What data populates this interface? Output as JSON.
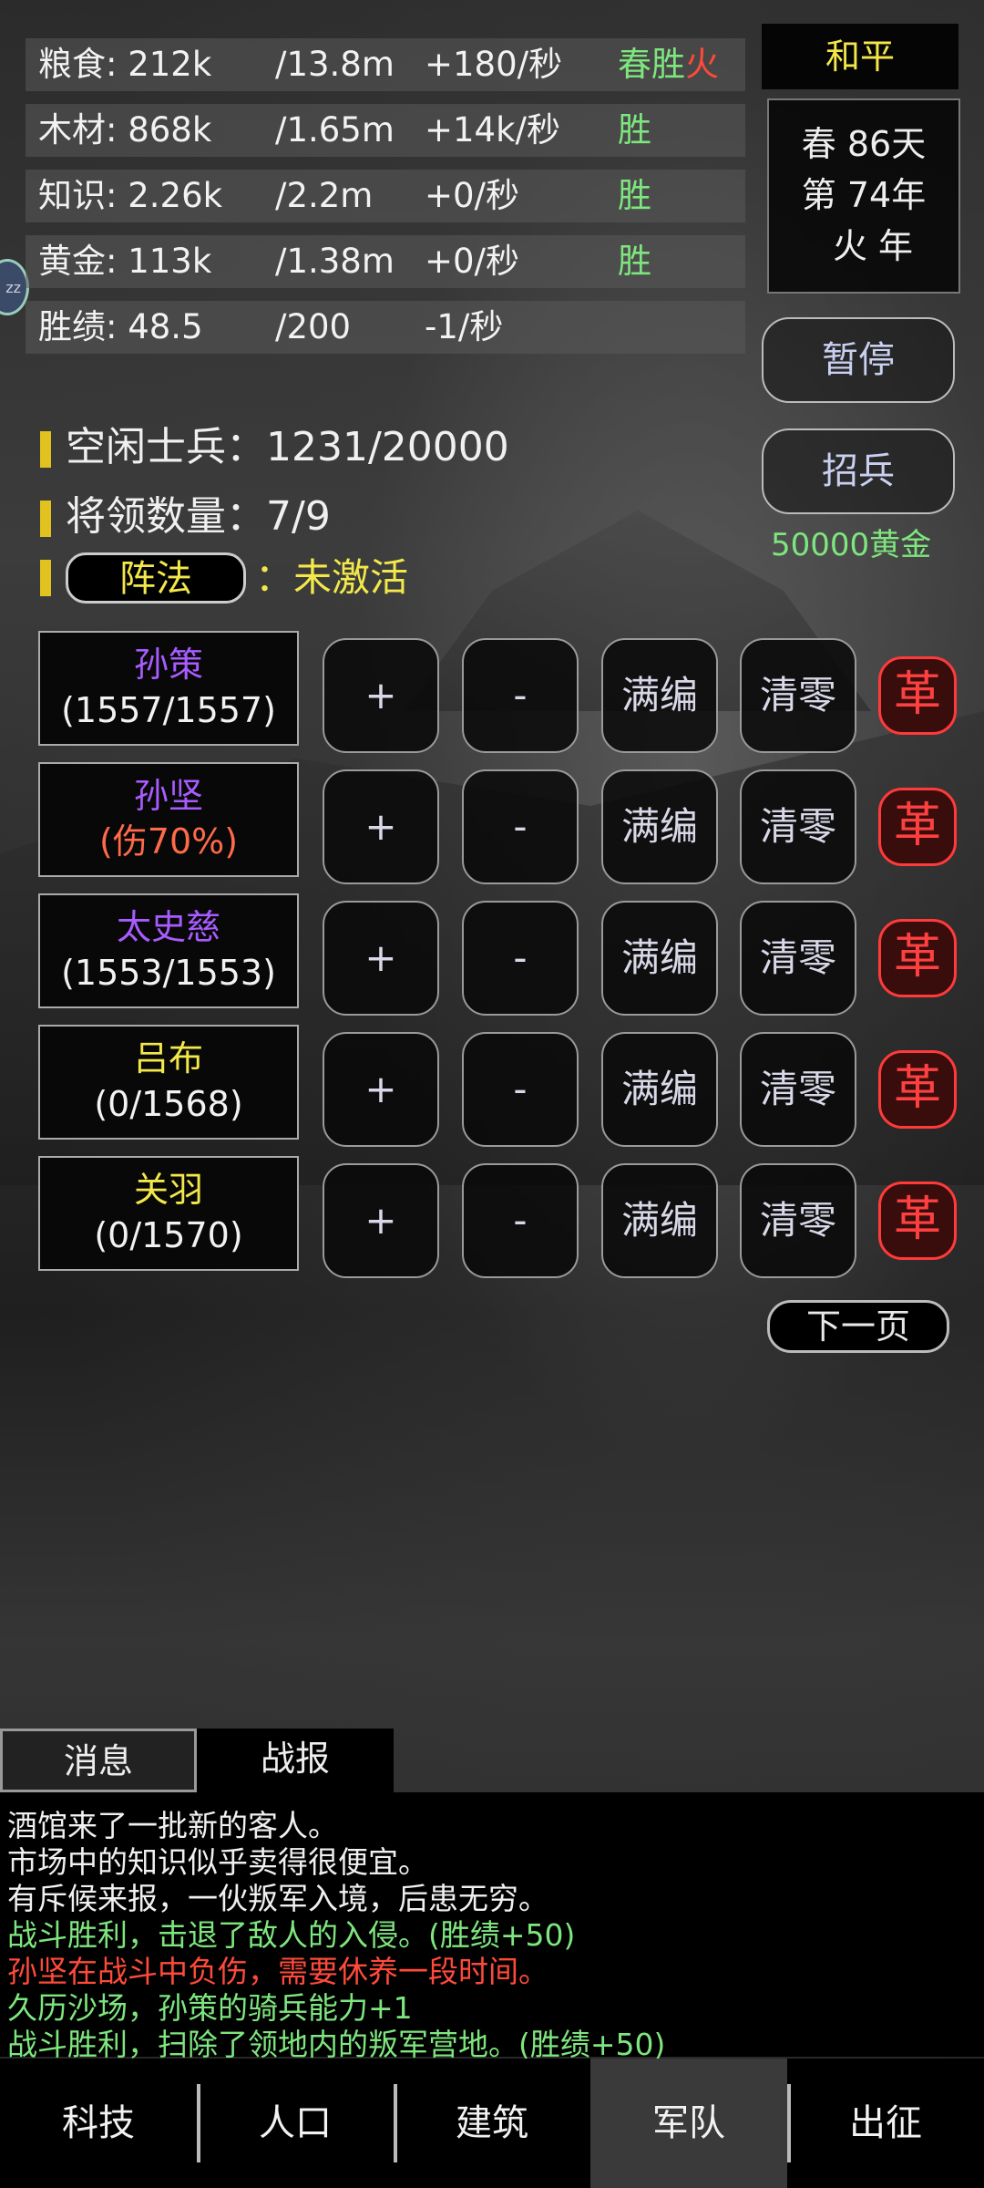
{
  "resources": [
    {
      "name": "粮食: 212k",
      "cap": "/13.8m",
      "rate": "+180/秒",
      "status": "春胜",
      "status_extra": "火"
    },
    {
      "name": "木材: 868k",
      "cap": "/1.65m",
      "rate": "+14k/秒",
      "status": "胜",
      "status_extra": ""
    },
    {
      "name": "知识: 2.26k",
      "cap": "/2.2m",
      "rate": "+0/秒",
      "status": "胜",
      "status_extra": ""
    },
    {
      "name": "黄金: 113k",
      "cap": "/1.38m",
      "rate": "+0/秒",
      "status": "胜",
      "status_extra": ""
    },
    {
      "name": "胜绩: 48.5",
      "cap": "/200",
      "rate": "-1/秒",
      "status": "",
      "status_extra": ""
    }
  ],
  "state": {
    "peace": "和平",
    "season_day": "春 86天",
    "year": "第 74年",
    "element_year": "火 年"
  },
  "buttons": {
    "pause": "暂停",
    "recruit": "招兵",
    "recruit_cost": "50000黄金",
    "next_page": "下一页"
  },
  "army": {
    "idle_soldiers": "空闲士兵：1231/20000",
    "generals_count": "将领数量：7/9",
    "formation_label": "阵法",
    "formation_status": "：未激活"
  },
  "generals": [
    {
      "name": "孙策",
      "troops": "(1557/1557)"
    },
    {
      "name": "孙坚",
      "troops": "(伤70%)"
    },
    {
      "name": "太史慈",
      "troops": "(1553/1553)"
    },
    {
      "name": "吕布",
      "troops": "(0/1568)"
    },
    {
      "name": "关羽",
      "troops": "(0/1570)"
    }
  ],
  "general_controls": {
    "add": "+",
    "remove": "-",
    "fill": "满编",
    "clear": "清零",
    "dismiss": "革"
  },
  "tabs": {
    "messages": "消息",
    "battle_report": "战报"
  },
  "log": [
    {
      "text": "酒馆来了一批新的客人。",
      "color": "white"
    },
    {
      "text": "市场中的知识似乎卖得很便宜。",
      "color": "white"
    },
    {
      "text": "有斥候来报，一伙叛军入境，后患无穷。",
      "color": "white"
    },
    {
      "text": "战斗胜利，击退了敌人的入侵。(胜绩+50)",
      "color": "green"
    },
    {
      "text": "孙坚在战斗中负伤，需要休养一段时间。",
      "color": "red"
    },
    {
      "text": "久历沙场，孙策的骑兵能力+1",
      "color": "green"
    },
    {
      "text": "战斗胜利，扫除了领地内的叛军营地。(胜绩+50)",
      "color": "green"
    }
  ],
  "nav": {
    "items": [
      "科技",
      "人口",
      "建筑",
      "军队",
      "出征"
    ],
    "active": "军队"
  },
  "colors": {
    "green": "#7ee67e",
    "yellow": "#f3e84a",
    "red": "#ff4a3a",
    "purple": "#a85cff"
  }
}
